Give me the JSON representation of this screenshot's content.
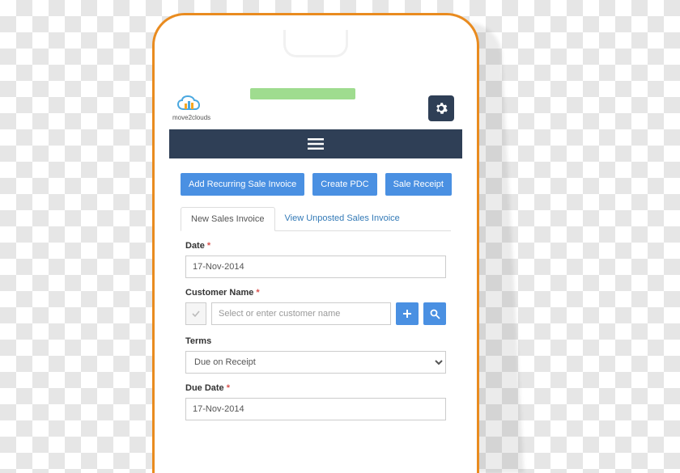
{
  "brand": {
    "name": "move2clouds"
  },
  "buttons": {
    "add_recurring": "Add Recurring Sale Invoice",
    "create_pdc": "Create PDC",
    "sale_receipt": "Sale Receipt"
  },
  "tabs": {
    "new": "New Sales Invoice",
    "unposted": "View Unposted Sales Invoice"
  },
  "form": {
    "date_label": "Date",
    "date_value": "17-Nov-2014",
    "customer_label": "Customer Name",
    "customer_placeholder": "Select or enter customer name",
    "terms_label": "Terms",
    "terms_value": "Due on Receipt",
    "due_date_label": "Due Date",
    "due_date_value": "17-Nov-2014"
  }
}
